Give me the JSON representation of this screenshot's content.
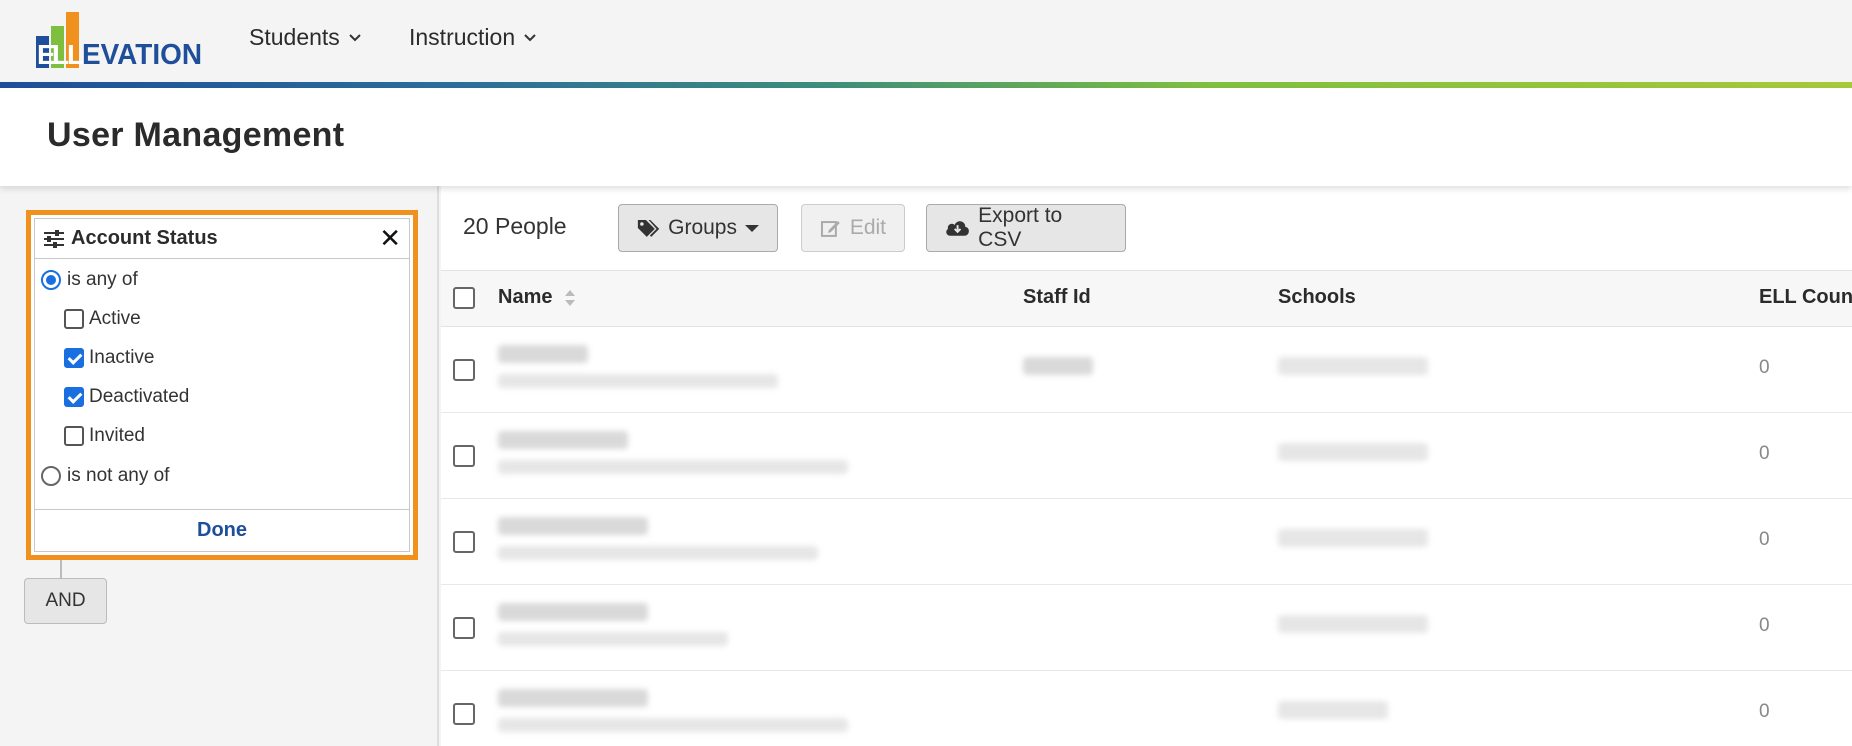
{
  "app": {
    "logo_text": "ELLEVATION",
    "nav": [
      {
        "label": "Students"
      },
      {
        "label": "Instruction"
      }
    ]
  },
  "page": {
    "title": "User Management"
  },
  "filter": {
    "title": "Account Status",
    "mode_any": "is any of",
    "mode_not": "is not any of",
    "selected_mode": "is any of",
    "options": [
      {
        "label": "Active",
        "checked": false
      },
      {
        "label": "Inactive",
        "checked": true
      },
      {
        "label": "Deactivated",
        "checked": true
      },
      {
        "label": "Invited",
        "checked": false
      }
    ],
    "done_label": "Done",
    "and_label": "AND"
  },
  "toolbar": {
    "people_count": "20 People",
    "groups_label": "Groups",
    "edit_label": "Edit",
    "export_label": "Export to CSV"
  },
  "table": {
    "columns": [
      "Name",
      "Staff Id",
      "Schools",
      "ELL Count"
    ],
    "rows": [
      {
        "ell_count": "0"
      },
      {
        "ell_count": "0"
      },
      {
        "ell_count": "0"
      },
      {
        "ell_count": "0"
      },
      {
        "ell_count": "0"
      }
    ]
  },
  "colors": {
    "accent_orange": "#f0911e",
    "brand_blue": "#1f4e9a",
    "checkbox_blue": "#1a6fe0",
    "brand_green": "#7fbf3f"
  }
}
